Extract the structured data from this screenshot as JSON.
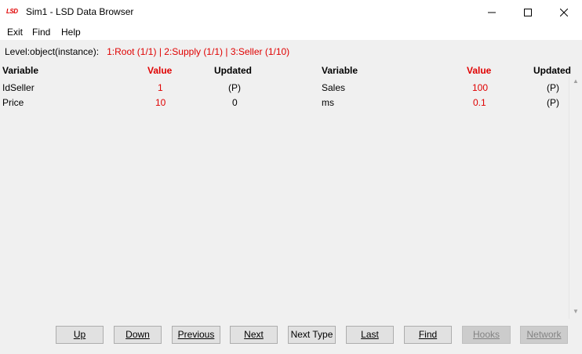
{
  "window": {
    "title": "Sim1 - LSD Data Browser",
    "icon_text": "LSD"
  },
  "menu": [
    "Exit",
    "Find",
    "Help"
  ],
  "level_bar": {
    "label": "Level:object(instance):",
    "items": [
      "1:Root (1/1)",
      "2:Supply (1/1)",
      "3:Seller (1/10)"
    ],
    "separator": "|"
  },
  "headers": {
    "variable": "Variable",
    "value": "Value",
    "updated": "Updated"
  },
  "left_rows": [
    {
      "variable": "IdSeller",
      "value": "1",
      "updated": "(P)"
    },
    {
      "variable": "Price",
      "value": "10",
      "updated": "0"
    }
  ],
  "right_rows": [
    {
      "variable": "Sales",
      "value": "100",
      "updated": "(P)"
    },
    {
      "variable": "ms",
      "value": "0.1",
      "updated": "(P)"
    }
  ],
  "buttons": [
    {
      "label": "Up",
      "enabled": true
    },
    {
      "label": "Down",
      "enabled": true
    },
    {
      "label": "Previous",
      "enabled": true
    },
    {
      "label": "Next",
      "enabled": true
    },
    {
      "label": "Next Type",
      "enabled": true
    },
    {
      "label": "Last",
      "enabled": true
    },
    {
      "label": "Find",
      "enabled": true
    },
    {
      "label": "Hooks",
      "enabled": false
    },
    {
      "label": "Network",
      "enabled": false
    }
  ],
  "colors": {
    "accent_red": "#e00000",
    "background": "#f0f0f0"
  }
}
